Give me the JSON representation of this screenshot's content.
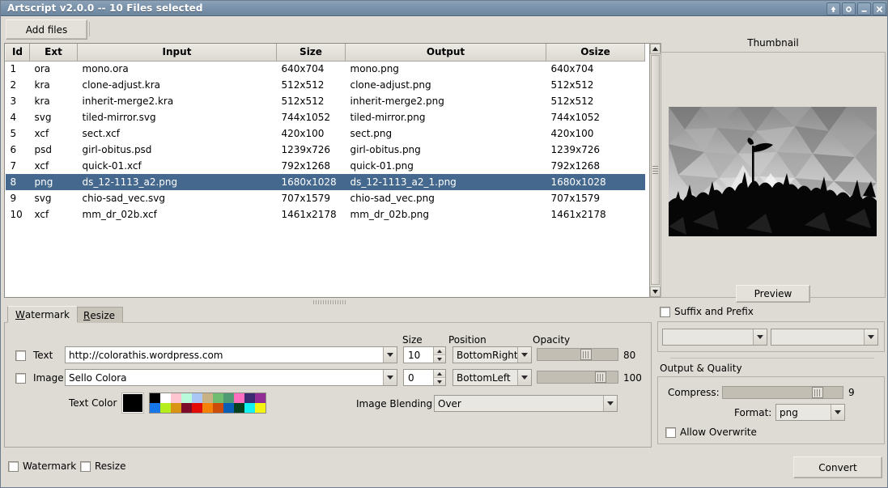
{
  "window": {
    "title": "Artscript v2.0.0 -- 10 Files selected",
    "buttons": {
      "shade": "shade-window",
      "sticky": "sticky-window",
      "minimize": "minimize-window",
      "close": "close-window"
    },
    "accent_titlebar": "#7b93ab",
    "selection_color": "#45698e",
    "background": "#dedbd4"
  },
  "toolbar": {
    "add_files_label": "Add files"
  },
  "filelist": {
    "columns": [
      "Id",
      "Ext",
      "Input",
      "Size",
      "Output",
      "Osize"
    ],
    "selected_row_index": 7,
    "rows": [
      {
        "id": "1",
        "ext": "ora",
        "input": "mono.ora",
        "size": "640x704",
        "output": "mono.png",
        "osize": "640x704"
      },
      {
        "id": "2",
        "ext": "kra",
        "input": "clone-adjust.kra",
        "size": "512x512",
        "output": "clone-adjust.png",
        "osize": "512x512"
      },
      {
        "id": "3",
        "ext": "kra",
        "input": "inherit-merge2.kra",
        "size": "512x512",
        "output": "inherit-merge2.png",
        "osize": "512x512"
      },
      {
        "id": "4",
        "ext": "svg",
        "input": "tiled-mirror.svg",
        "size": "744x1052",
        "output": "tiled-mirror.png",
        "osize": "744x1052"
      },
      {
        "id": "5",
        "ext": "xcf",
        "input": "sect.xcf",
        "size": "420x100",
        "output": "sect.png",
        "osize": "420x100"
      },
      {
        "id": "6",
        "ext": "psd",
        "input": "girl-obitus.psd",
        "size": "1239x726",
        "output": "girl-obitus.png",
        "osize": "1239x726"
      },
      {
        "id": "7",
        "ext": "xcf",
        "input": "quick-01.xcf",
        "size": "792x1268",
        "output": "quick-01.png",
        "osize": "792x1268"
      },
      {
        "id": "8",
        "ext": "png",
        "input": "ds_12-1113_a2.png",
        "size": "1680x1028",
        "output": "ds_12-1113_a2_1.png",
        "osize": "1680x1028"
      },
      {
        "id": "9",
        "ext": "svg",
        "input": "chio-sad_vec.svg",
        "size": "707x1579",
        "output": "chio-sad_vec.png",
        "osize": "707x1579"
      },
      {
        "id": "10",
        "ext": "xcf",
        "input": "mm_dr_02b.xcf",
        "size": "1461x2178",
        "output": "mm_dr_02b.png",
        "osize": "1461x2178"
      }
    ]
  },
  "tabs": {
    "watermark": {
      "prefix": "W",
      "rest": "atermark"
    },
    "resize": {
      "prefix": "R",
      "rest": "esize"
    },
    "active": "watermark"
  },
  "watermark_panel": {
    "headers": {
      "size": "Size",
      "position": "Position",
      "opacity": "Opacity"
    },
    "text_row": {
      "label": "Text",
      "checked": false,
      "value": "http://colorathis.wordpress.com",
      "size": "10",
      "position": "BottomRight",
      "opacity": "80",
      "opacity_pct": 62
    },
    "image_row": {
      "label": "Image",
      "checked": false,
      "value": "Sello Colora",
      "size": "0",
      "position": "BottomLeft",
      "opacity": "100",
      "opacity_pct": 83
    },
    "text_color": {
      "label": "Text Color",
      "current": "#000000",
      "palette_row1": [
        "#000000",
        "#ffffff",
        "#ffc6d2",
        "#b9fada",
        "#a9c6f5",
        "#c8b184",
        "#6fbd70",
        "#4f9b74",
        "#ff6fc0",
        "#3c2b70",
        "#932d96"
      ],
      "palette_row2": [
        "#1877e8",
        "#b6ed1e",
        "#d99414",
        "#7c0c2a",
        "#e20b06",
        "#f58208",
        "#cc4d09",
        "#0a5fb4",
        "#07401f",
        "#13f1f1",
        "#f4f412"
      ]
    },
    "image_blending": {
      "label": "Image Blending",
      "value": "Over"
    }
  },
  "thumbnail": {
    "title": "Thumbnail",
    "preview_label": "Preview",
    "image_alt": "grayscale-low-poly-silhouette"
  },
  "suffix_prefix": {
    "label": "Suffix and Prefix",
    "checked": false,
    "prefix_value": "",
    "suffix_value": ""
  },
  "output_quality": {
    "title": "Output & Quality",
    "compress_label": "Compress:",
    "compress_value": "9",
    "compress_pct": 82,
    "format_label": "Format:",
    "format_value": "png",
    "allow_overwrite_label": "Allow Overwrite",
    "allow_overwrite_checked": false
  },
  "bottom_bar": {
    "watermark_label": "Watermark",
    "watermark_checked": false,
    "resize_label": "Resize",
    "resize_checked": false,
    "convert_label": "Convert"
  }
}
